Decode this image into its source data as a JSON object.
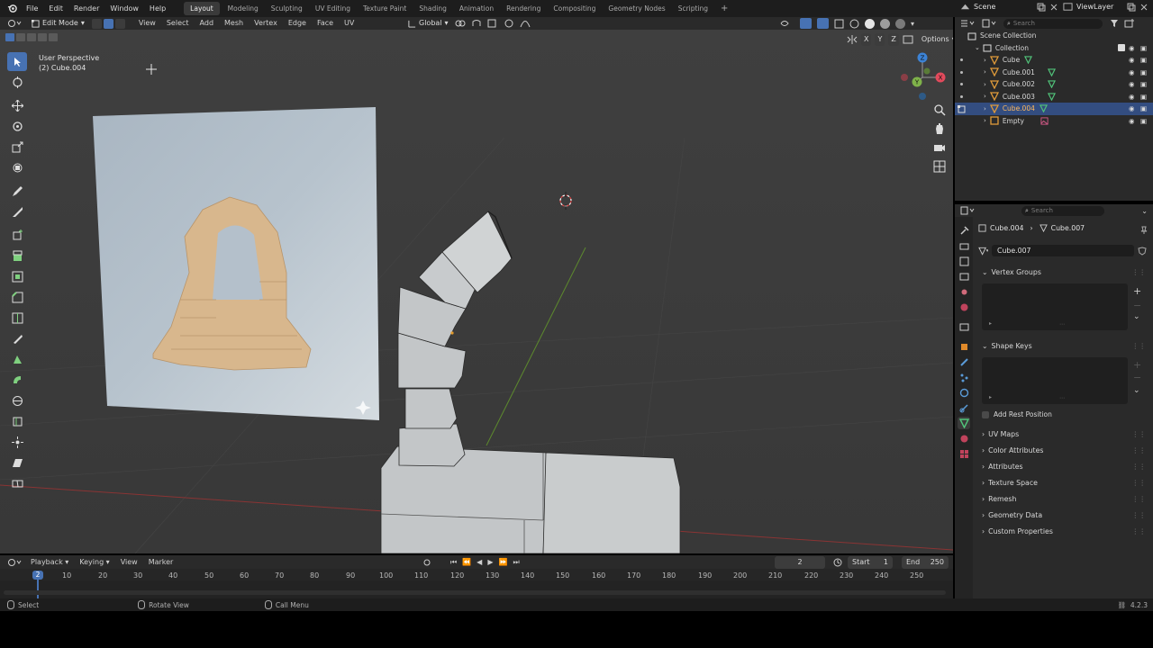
{
  "topbar": {
    "menus": [
      "File",
      "Edit",
      "Render",
      "Window",
      "Help"
    ],
    "workspaces": [
      "Layout",
      "Modeling",
      "Sculpting",
      "UV Editing",
      "Texture Paint",
      "Shading",
      "Animation",
      "Rendering",
      "Compositing",
      "Geometry Nodes",
      "Scripting"
    ],
    "active_workspace": "Layout",
    "add_tab": "+",
    "scene": "Scene",
    "view_layer": "ViewLayer"
  },
  "viewport_header": {
    "mode": "Edit Mode",
    "menus": [
      "View",
      "Select",
      "Add",
      "Mesh",
      "Vertex",
      "Edge",
      "Face",
      "UV"
    ],
    "transform_orientation": "Global",
    "axis_x": "X",
    "axis_y": "Y",
    "axis_z": "Z",
    "options": "Options"
  },
  "viewport": {
    "perspective_label": "User Perspective",
    "object_label": "(2) Cube.004",
    "gizmo": {
      "x": "X",
      "y": "Y",
      "z": "Z"
    }
  },
  "outliner": {
    "search_placeholder": "Search",
    "scene_collection": "Scene Collection",
    "collection": "Collection",
    "items": [
      {
        "name": "Cube",
        "selected": false
      },
      {
        "name": "Cube.001",
        "selected": false
      },
      {
        "name": "Cube.002",
        "selected": false
      },
      {
        "name": "Cube.003",
        "selected": false
      },
      {
        "name": "Cube.004",
        "selected": true
      },
      {
        "name": "Empty",
        "selected": false
      }
    ]
  },
  "properties": {
    "search_placeholder": "Search",
    "breadcrumb_object": "Cube.004",
    "breadcrumb_mesh": "Cube.007",
    "datablock_name": "Cube.007",
    "vertex_groups": "Vertex Groups",
    "shape_keys": "Shape Keys",
    "add_rest_position": "Add Rest Position",
    "collapsed_panels": [
      "UV Maps",
      "Color Attributes",
      "Attributes",
      "Texture Space",
      "Remesh",
      "Geometry Data",
      "Custom Properties"
    ]
  },
  "timeline": {
    "menus": [
      "Playback",
      "Keying",
      "View",
      "Marker"
    ],
    "current_frame": "2",
    "start_label": "Start",
    "start_value": "1",
    "end_label": "End",
    "end_value": "250",
    "ticks": [
      "10",
      "20",
      "30",
      "40",
      "50",
      "60",
      "70",
      "80",
      "90",
      "100",
      "110",
      "120",
      "130",
      "140",
      "150",
      "160",
      "170",
      "180",
      "190",
      "200",
      "210",
      "220",
      "230",
      "240",
      "250"
    ],
    "playhead_label": "2"
  },
  "statusbar": {
    "select": "Select",
    "rotate_view": "Rotate View",
    "call_menu": "Call Menu",
    "version": "4.2.3"
  },
  "colors": {
    "accent": "#4772b3",
    "selected_row": "#334d80",
    "mesh_icon": "#51c47a",
    "object_icon": "#e09b3a"
  }
}
